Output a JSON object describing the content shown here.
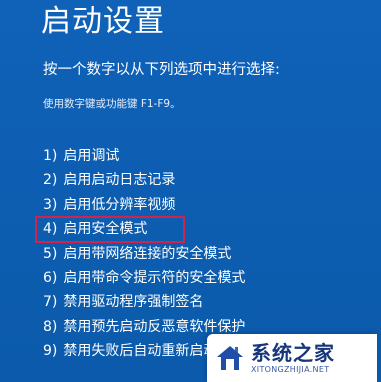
{
  "title": "启动设置",
  "prompt": "按一个数字以从下列选项中进行选择:",
  "hint": "使用数字键或功能键 F1-F9。",
  "options": [
    {
      "num": "1)",
      "label": "启用调试"
    },
    {
      "num": "2)",
      "label": "启用启动日志记录"
    },
    {
      "num": "3)",
      "label": "启用低分辨率视频"
    },
    {
      "num": "4)",
      "label": "启用安全模式"
    },
    {
      "num": "5)",
      "label": "启用带网络连接的安全模式"
    },
    {
      "num": "6)",
      "label": "启用带命令提示符的安全模式"
    },
    {
      "num": "7)",
      "label": "禁用驱动程序强制签名"
    },
    {
      "num": "8)",
      "label": "禁用预先启动反恶意软件保护"
    },
    {
      "num": "9)",
      "label": "禁用失败后自动重新启动"
    }
  ],
  "highlighted_option": "4)",
  "watermark": {
    "name": "系统之家",
    "url": "XITONGZHIJIA.NET",
    "icon": "house-logo-icon"
  },
  "colors": {
    "background": "#0d5db3",
    "highlight_border": "#d2234b",
    "text": "#ffffff"
  }
}
